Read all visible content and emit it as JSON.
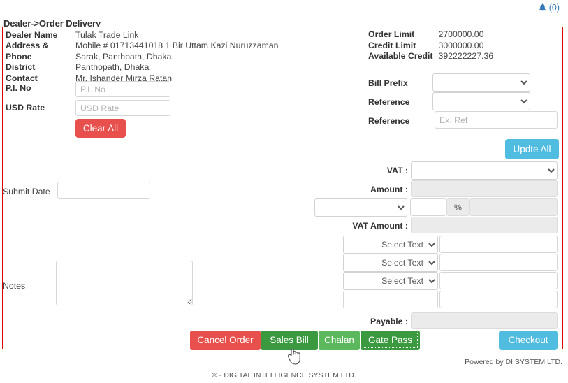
{
  "topbar": {
    "bell_icon": "bell-icon",
    "notification_count": "(0)"
  },
  "page_title": "Dealer->Order Delivery",
  "dealer_info": {
    "rows": [
      {
        "label": "Dealer Name",
        "value": "Tulak Trade Link"
      },
      {
        "label": "Address & Phone",
        "value": "Mobile # 01713441018 1 Bir Uttam Kazi Nuruzzaman Sarak, Panthpath, Dhaka."
      },
      {
        "label": "District",
        "value": "Panthopath, Dhaka"
      },
      {
        "label": "Contact",
        "value": "Mr. Ishander Mirza Ratan"
      }
    ],
    "pi_no_label": "P.I. No",
    "pi_no_placeholder": "P.I. No",
    "pi_no_value": "",
    "usd_rate_label": "USD Rate",
    "usd_rate_placeholder": "USD Rate",
    "usd_rate_value": "",
    "clear_all_label": "Clear All"
  },
  "limits": {
    "order_limit_label": "Order Limit",
    "order_limit_value": "2700000.00",
    "credit_limit_label": "Credit Limit",
    "credit_limit_value": "3000000.00",
    "available_credit_label": "Available Credit",
    "available_credit_value": "392222227.36",
    "bill_prefix_label": "Bill Prefix",
    "bill_prefix_value": "",
    "reference_select_label": "Reference",
    "reference_select_value": "",
    "reference_text_label": "Reference",
    "reference_text_placeholder": "Ex. Ref",
    "reference_text_value": ""
  },
  "update_all_label": "Updte All",
  "calc": {
    "vat_label": "VAT :",
    "vat_value": "",
    "amount_label": "Amount :",
    "amount_value": "",
    "discount_select_value": "",
    "discount_number_value": "",
    "percent_symbol": "%",
    "discount_amount_value": "",
    "vat_amount_label": "VAT Amount :",
    "vat_amount_value": "",
    "charge_rows": [
      {
        "select_value": "Select Text",
        "text_value": ""
      },
      {
        "select_value": "Select Text",
        "text_value": ""
      },
      {
        "select_value": "Select Text",
        "text_value": ""
      }
    ],
    "extra_row": {
      "left_value": "",
      "right_value": ""
    },
    "payable_label": "Payable :",
    "payable_value": ""
  },
  "submit_date": {
    "label": "Submit Date",
    "value": "",
    "placeholder": ""
  },
  "notes": {
    "label": "Notes",
    "value": "",
    "placeholder": ""
  },
  "actions": {
    "cancel_order": "Cancel Order",
    "sales_bill": "Sales Bill",
    "chalan": "Chalan",
    "gate_pass": "Gate Pass",
    "checkout": "Checkout"
  },
  "footer": {
    "powered_by": "Powered by DI SYSTEM LTD.",
    "copyright": "®  - DIGITAL INTELLIGENCE SYSTEM LTD."
  },
  "colors": {
    "panel_border": "#e00000",
    "accent_blue": "#50bcdf",
    "danger_red": "#e8504d",
    "green_dark": "#3b9a3f",
    "green_light": "#5cb85c",
    "link_blue": "#337ab7"
  }
}
